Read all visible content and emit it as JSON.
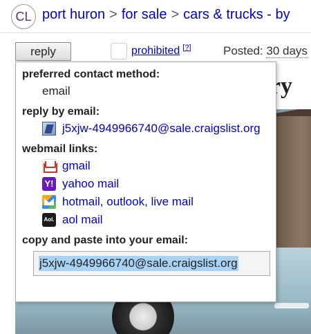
{
  "header": {
    "logo": "CL",
    "breadcrumbs": [
      "port huron",
      "for sale",
      "cars & trucks - by"
    ],
    "separator": ">"
  },
  "toolbar": {
    "reply_label": "reply",
    "prohibited_label": "prohibited",
    "help_marker": "[?]",
    "posted_label": "Posted:",
    "posted_value": "30 days"
  },
  "background": {
    "title_fragment": "ury"
  },
  "reply_popup": {
    "contact_heading": "preferred contact method:",
    "contact_value": "email",
    "email_heading": "reply by email:",
    "email_address": "j5xjw-4949966740@sale.craigslist.org",
    "webmail_heading": "webmail links:",
    "webmail_links": [
      "gmail",
      "yahoo mail",
      "hotmail, outlook, live mail",
      "aol mail"
    ],
    "copy_heading": "copy and paste into your email:",
    "copy_value": "j5xjw-4949966740@sale.craigslist.org"
  },
  "icons": {
    "yahoo_glyph": "Y!",
    "aol_glyph": "Aol."
  }
}
